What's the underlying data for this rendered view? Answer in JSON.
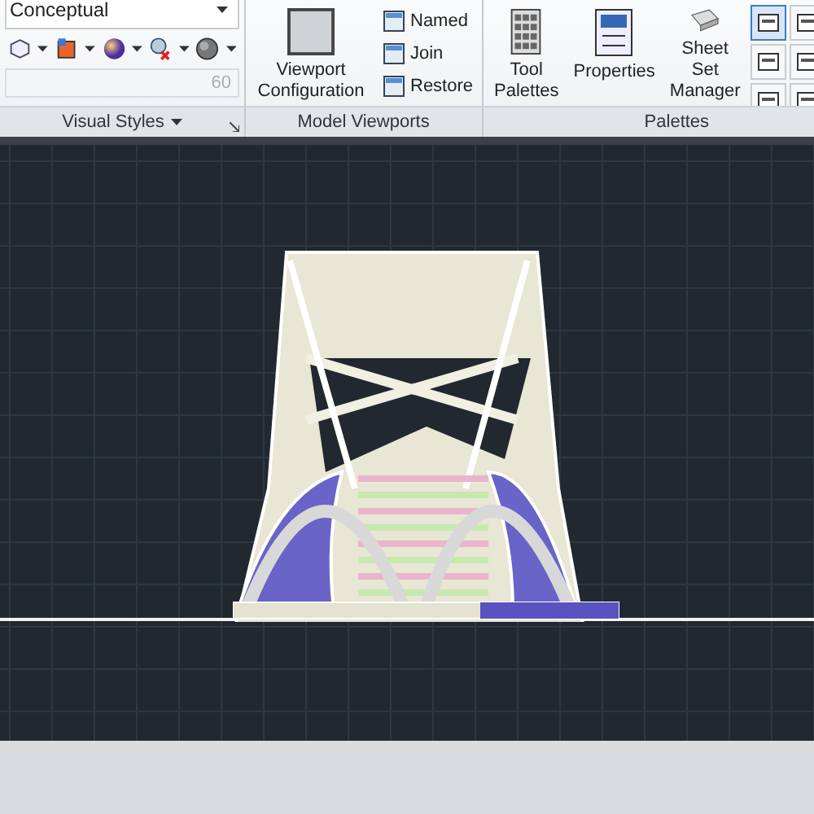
{
  "ribbon": {
    "panels": [
      {
        "kind": "visual-styles",
        "title": "Visual Styles",
        "style_dropdown": {
          "value": "Conceptual"
        },
        "opacity_field": {
          "value": "60",
          "disabled": true
        }
      },
      {
        "kind": "model-viewports",
        "title": "Model Viewports",
        "large_button": {
          "label": "Viewport Configuration"
        },
        "small_buttons": [
          "Named",
          "Join",
          "Restore"
        ]
      },
      {
        "kind": "palettes",
        "title": "Palettes",
        "large_buttons": [
          "Tool Palettes",
          "Properties",
          "Sheet Set Manager"
        ]
      }
    ]
  }
}
